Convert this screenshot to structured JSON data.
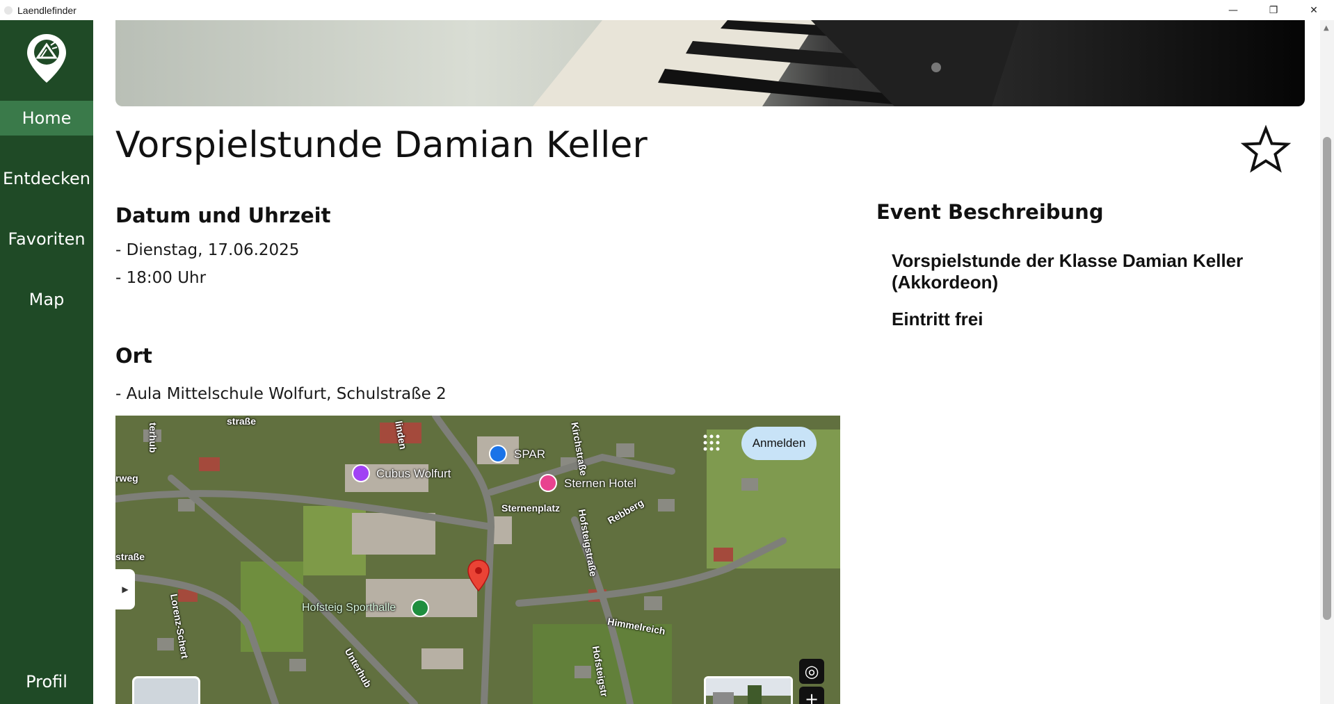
{
  "window": {
    "title": "Laendlefinder",
    "minimize": "—",
    "restore": "❐",
    "close": "✕"
  },
  "sidebar": {
    "items": [
      {
        "label": "Home",
        "active": true
      },
      {
        "label": "Entdecken"
      },
      {
        "label": "Favoriten"
      },
      {
        "label": "Map"
      }
    ],
    "profile": "Profil",
    "colors": {
      "background": "#1f4a26",
      "active": "#3a7a4a"
    }
  },
  "event": {
    "title": "Vorspielstunde Damian Keller",
    "favorite_icon": "star-outline-icon",
    "datetime": {
      "heading": "Datum und Uhrzeit",
      "date": "- Dienstag, 17.06.2025",
      "time": "- 18:00 Uhr"
    },
    "location": {
      "heading": "Ort",
      "address": "- Aula Mittelschule Wolfurt, Schulstraße 2"
    },
    "description": {
      "heading": "Event Beschreibung",
      "line1": "Vorspielstunde der Klasse Damian Keller (Akkordeon)",
      "line2": "Eintritt frei"
    }
  },
  "map": {
    "signin": "Anmelden",
    "places": {
      "spar": "SPAR",
      "cubus": "Cubus Wolfurt",
      "sternen": "Sternen Hotel",
      "sternenplatz": "Sternenplatz",
      "sporthalle": "Hofsteig Sporthalle",
      "rebberg": "Rebberg",
      "himmelreich": "Himmelreich",
      "kirchstrasse": "Kirchstraße",
      "hofsteigstrasse": "Hofsteigstraße",
      "hofsteigstr": "Hofsteigstr",
      "unterhub": "Unterhub",
      "lorenz": "Lorenz-Schert",
      "linden": "linden",
      "strasse_left": "straße",
      "weg": "rweg",
      "terhub": "terhub",
      "strasse_top": "straße"
    },
    "controls": {
      "locate": "◎",
      "zoom_in": "+"
    }
  }
}
